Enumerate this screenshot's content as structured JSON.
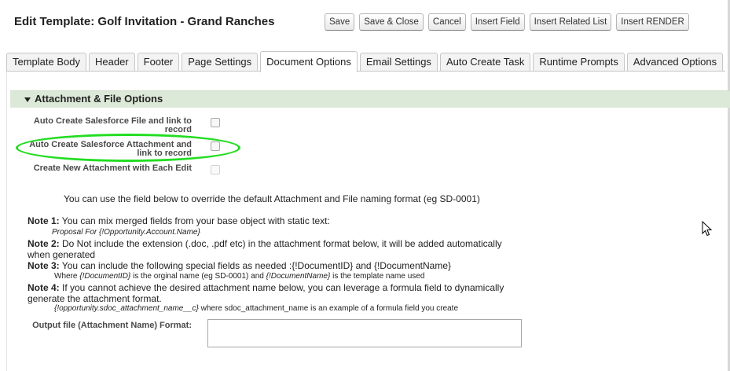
{
  "window": {
    "title": "Edit Template: Golf Invitation - Grand Ranches"
  },
  "toolbar": {
    "save": "Save",
    "save_close": "Save & Close",
    "cancel": "Cancel",
    "insert_field": "Insert Field",
    "insert_related_list": "Insert Related List",
    "insert_render": "Insert RENDER"
  },
  "tabs": [
    {
      "label": "Template Body",
      "active": false
    },
    {
      "label": "Header",
      "active": false
    },
    {
      "label": "Footer",
      "active": false
    },
    {
      "label": "Page Settings",
      "active": false
    },
    {
      "label": "Document Options",
      "active": true
    },
    {
      "label": "Email Settings",
      "active": false
    },
    {
      "label": "Auto Create Task",
      "active": false
    },
    {
      "label": "Runtime Prompts",
      "active": false
    },
    {
      "label": "Advanced Options",
      "active": false
    }
  ],
  "section": {
    "title": "Attachment & File Options"
  },
  "options": [
    {
      "label": "Auto Create Salesforce File and link to record",
      "checked": false,
      "disabled": false
    },
    {
      "label": "Auto Create Salesforce Attachment and link to record",
      "checked": false,
      "disabled": false
    },
    {
      "label": "Create New Attachment with Each Edit",
      "checked": false,
      "disabled": true
    }
  ],
  "override_text": "You can use the field below to override the default Attachment and File naming format (eg SD-0001)",
  "notes": {
    "note1_label": "Note 1:",
    "note1_text": " You can mix merged fields from your base object with static text:",
    "note1_example": "Proposal For {!Opportunity.Account.Name}",
    "note2_label": "Note 2:",
    "note2_text": " Do Not include the extension (.doc, .pdf etc) in the attachment format below, it will be added automatically when generated",
    "note3_label": "Note 3:",
    "note3_text": " You can include the following special fields as needed :{!DocumentID} and {!DocumentName}",
    "note3_where": "Where ",
    "note3_docid": "{!DocumentID}",
    "note3_mid": " is the orginal name (eg SD-0001) and ",
    "note3_docname": "{!DocumentName}",
    "note3_end": " is the template name used",
    "note4_label": "Note 4:",
    "note4_text": " If you cannot achieve the desired attachment name below, you can leverage a formula field to dynamically generate the attachment format.",
    "note4_field": "{!opportunity.sdoc_attachment_name__c}",
    "note4_end": " where sdoc_attachment_name is an example of a formula field you create"
  },
  "output": {
    "label": "Output file (Attachment Name) Format:",
    "value": ""
  },
  "colors": {
    "section_bg": "#dde9d8",
    "highlight": "#22dd22"
  }
}
